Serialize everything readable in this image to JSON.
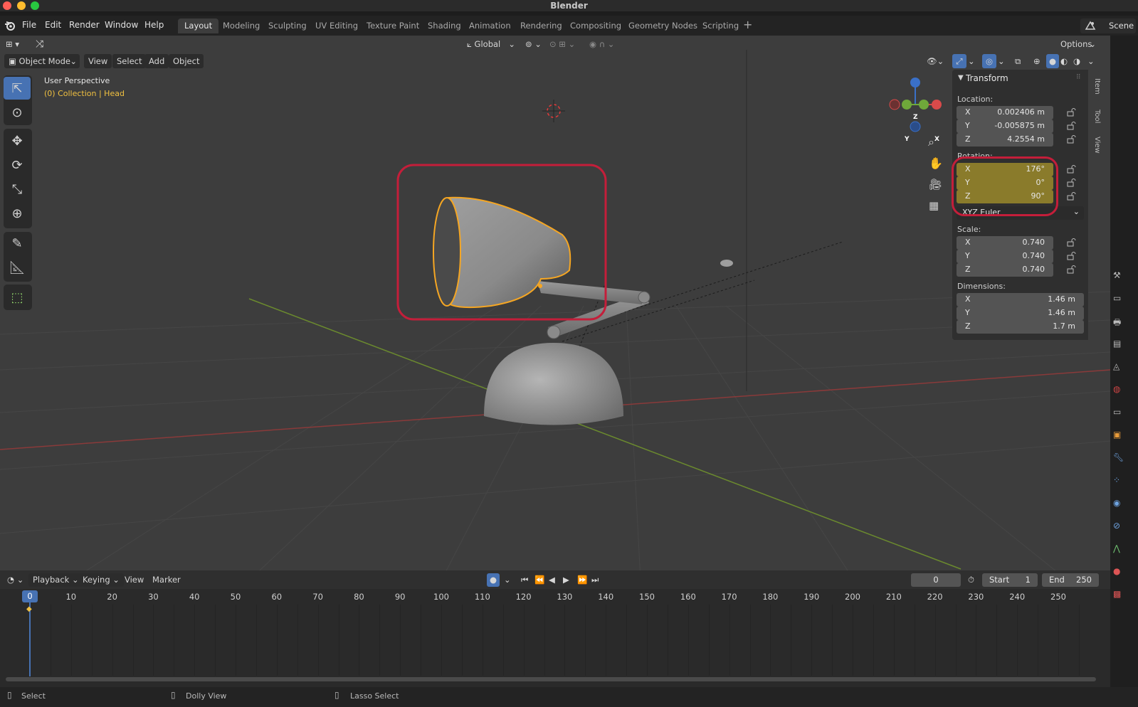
{
  "window": {
    "title": "Blender"
  },
  "menu": [
    "File",
    "Edit",
    "Render",
    "Window",
    "Help"
  ],
  "workspaces": [
    "Layout",
    "Modeling",
    "Sculpting",
    "UV Editing",
    "Texture Paint",
    "Shading",
    "Animation",
    "Rendering",
    "Compositing",
    "Geometry Nodes",
    "Scripting"
  ],
  "active_workspace": "Layout",
  "scene_label": "Scene",
  "viewport": {
    "transform_orientation": "Global",
    "options_label": "Options",
    "mode": "Object Mode",
    "header_menus": [
      "View",
      "Select",
      "Add",
      "Object"
    ],
    "perspective": "User Perspective",
    "collection_info": "(0) Collection | Head"
  },
  "gizmo": {
    "x": "X",
    "y": "Y",
    "z": "Z"
  },
  "npanel": {
    "section": "Transform",
    "tabs": [
      "Item",
      "Tool",
      "View"
    ],
    "location_label": "Location:",
    "location": [
      {
        "axis": "X",
        "value": "0.002406 m"
      },
      {
        "axis": "Y",
        "value": "-0.005875 m"
      },
      {
        "axis": "Z",
        "value": "4.2554 m"
      }
    ],
    "rotation_label": "Rotation:",
    "rotation": [
      {
        "axis": "X",
        "value": "176°"
      },
      {
        "axis": "Y",
        "value": "0°"
      },
      {
        "axis": "Z",
        "value": "90°"
      }
    ],
    "rotation_mode": "XYZ Euler",
    "scale_label": "Scale:",
    "scale": [
      {
        "axis": "X",
        "value": "0.740"
      },
      {
        "axis": "Y",
        "value": "0.740"
      },
      {
        "axis": "Z",
        "value": "0.740"
      }
    ],
    "dimensions_label": "Dimensions:",
    "dimensions": [
      {
        "axis": "X",
        "value": "1.46 m"
      },
      {
        "axis": "Y",
        "value": "1.46 m"
      },
      {
        "axis": "Z",
        "value": "1.7 m"
      }
    ]
  },
  "timeline": {
    "menus": [
      "Playback",
      "Keying",
      "View",
      "Marker"
    ],
    "current_frame": "0",
    "start_label": "Start",
    "start": "1",
    "end_label": "End",
    "end": "250",
    "ticks": [
      "0",
      "10",
      "20",
      "30",
      "40",
      "50",
      "60",
      "70",
      "80",
      "90",
      "100",
      "110",
      "120",
      "130",
      "140",
      "150",
      "160",
      "170",
      "180",
      "190",
      "200",
      "210",
      "220",
      "230",
      "240",
      "250"
    ]
  },
  "status": {
    "select": "Select",
    "dolly": "Dolly View",
    "lasso": "Lasso Select"
  },
  "colors": {
    "accent": "#4772b3",
    "selection": "#f5a623",
    "annotation": "#c41e3a",
    "rotation_highlight": "#8a7b2b"
  }
}
